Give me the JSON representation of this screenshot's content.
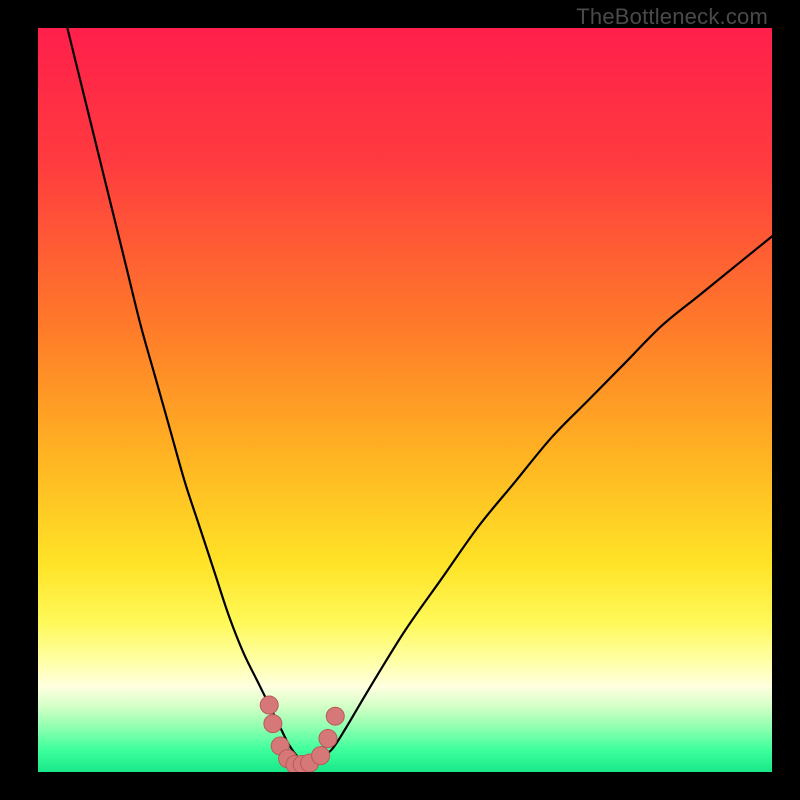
{
  "watermark": "TheBottleneck.com",
  "colors": {
    "background": "#000000",
    "curve": "#000000",
    "markers_fill": "#d77878",
    "markers_stroke": "#b85a5a",
    "gradient_stops": [
      {
        "offset": 0.0,
        "color": "#ff1f4b"
      },
      {
        "offset": 0.18,
        "color": "#ff3b3f"
      },
      {
        "offset": 0.4,
        "color": "#ff7a2a"
      },
      {
        "offset": 0.58,
        "color": "#ffb522"
      },
      {
        "offset": 0.72,
        "color": "#ffe327"
      },
      {
        "offset": 0.8,
        "color": "#fff95a"
      },
      {
        "offset": 0.85,
        "color": "#ffffa5"
      },
      {
        "offset": 0.885,
        "color": "#ffffe0"
      },
      {
        "offset": 0.91,
        "color": "#d7ffc8"
      },
      {
        "offset": 0.94,
        "color": "#8fffb0"
      },
      {
        "offset": 0.97,
        "color": "#3fff9d"
      },
      {
        "offset": 1.0,
        "color": "#18e889"
      }
    ]
  },
  "chart_data": {
    "type": "line",
    "title": "",
    "xlabel": "",
    "ylabel": "",
    "xlim": [
      0,
      100
    ],
    "ylim": [
      0,
      100
    ],
    "series": [
      {
        "name": "curve",
        "x": [
          4,
          6,
          8,
          10,
          12,
          14,
          16,
          18,
          20,
          22,
          24,
          26,
          28,
          30,
          32,
          33,
          34,
          35,
          36,
          37,
          38,
          40,
          42,
          45,
          50,
          55,
          60,
          65,
          70,
          75,
          80,
          85,
          90,
          95,
          100
        ],
        "y": [
          100,
          92,
          84,
          76,
          68,
          60,
          53,
          46,
          39,
          33,
          27,
          21,
          16,
          12,
          8,
          6,
          4,
          2.5,
          1.5,
          1,
          1.5,
          3,
          6,
          11,
          19,
          26,
          33,
          39,
          45,
          50,
          55,
          60,
          64,
          68,
          72
        ]
      }
    ],
    "markers": {
      "name": "highlighted-points",
      "x": [
        31.5,
        32.0,
        33.0,
        34.0,
        35.0,
        36.0,
        37.0,
        38.5,
        39.5,
        40.5
      ],
      "y": [
        9.0,
        6.5,
        3.5,
        1.8,
        1.0,
        1.0,
        1.2,
        2.2,
        4.5,
        7.5
      ]
    }
  }
}
